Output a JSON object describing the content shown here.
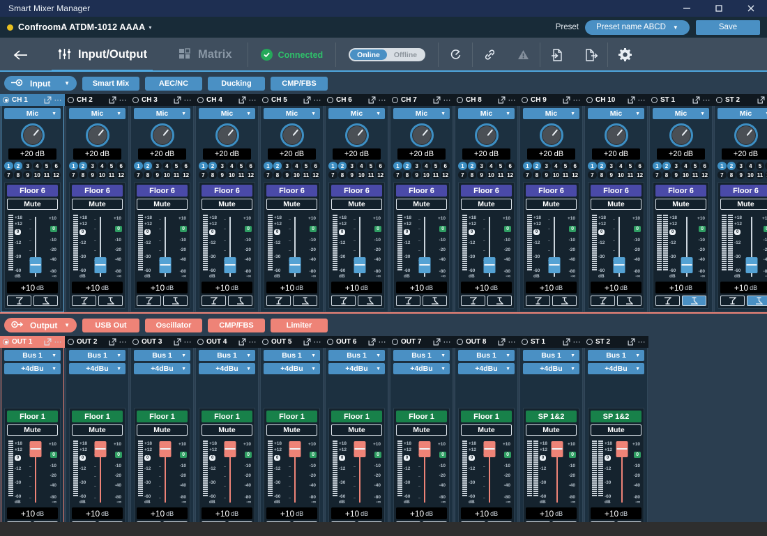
{
  "window": {
    "title": "Smart Mixer Manager",
    "minimize_icon": "minimize-icon",
    "maximize_icon": "maximize-icon",
    "close_icon": "close-icon"
  },
  "device_bar": {
    "status_dot_color": "#e8c020",
    "device_name": "ConfroomA ATDM-1012 AAAA",
    "caret": "▾",
    "preset_label": "Preset",
    "preset_value": "Preset name ABCD",
    "save_label": "Save"
  },
  "navbar": {
    "back_icon": "back-arrow-icon",
    "tabs": [
      {
        "label": "Input/Output",
        "icon": "sliders-icon",
        "active": true
      },
      {
        "label": "Matrix",
        "icon": "grid-icon",
        "active": false
      }
    ],
    "connection_status": "Connected",
    "online_label": "Online",
    "offline_label": "Offline",
    "online_active": true,
    "icons": [
      "refresh-icon",
      "link-icon",
      "warning-icon",
      "import-icon",
      "export-icon",
      "gear-icon"
    ],
    "accent_color": "#4fa8e0",
    "connected_color": "#2fc06a"
  },
  "input_section": {
    "pill_label": "Input",
    "pill_icon": "input-arrow-icon",
    "pill_color": "#4a90c4",
    "buttons": [
      "Smart Mix",
      "AEC/NC",
      "Ducking",
      "CMP/FBS"
    ],
    "scale_meter": [
      "+18",
      "+12",
      "0",
      "-12",
      "-30",
      "-60",
      "dB"
    ],
    "scale_fader": [
      "+10",
      "0",
      "-10",
      "-20",
      "-40",
      "-80",
      "-∞"
    ],
    "gain_unit": "dB",
    "mute_label": "Mute",
    "eq_icons": [
      "highpass-filter-icon",
      "lowpass-filter-icon"
    ],
    "num_pad": [
      "1",
      "2",
      "3",
      "4",
      "5",
      "6",
      "7",
      "8",
      "9",
      "10",
      "11",
      "12"
    ],
    "num_pad_active": [
      "1",
      "2"
    ],
    "channels": [
      {
        "name": "CH 1",
        "selected": true,
        "source": "Mic",
        "gain": "+20 dB",
        "bus": "Floor 6",
        "level": "+10",
        "stereo": false,
        "eq_left_on": false,
        "eq_right_on": false
      },
      {
        "name": "CH 2",
        "selected": false,
        "source": "Mic",
        "gain": "+20 dB",
        "bus": "Floor 6",
        "level": "+10",
        "stereo": false,
        "eq_left_on": false,
        "eq_right_on": false
      },
      {
        "name": "CH 3",
        "selected": false,
        "source": "Mic",
        "gain": "+20 dB",
        "bus": "Floor 6",
        "level": "+10",
        "stereo": false,
        "eq_left_on": false,
        "eq_right_on": false
      },
      {
        "name": "CH 4",
        "selected": false,
        "source": "Mic",
        "gain": "+20 dB",
        "bus": "Floor 6",
        "level": "+10",
        "stereo": false,
        "eq_left_on": false,
        "eq_right_on": false
      },
      {
        "name": "CH 5",
        "selected": false,
        "source": "Mic",
        "gain": "+20 dB",
        "bus": "Floor 6",
        "level": "+10",
        "stereo": false,
        "eq_left_on": false,
        "eq_right_on": false
      },
      {
        "name": "CH 6",
        "selected": false,
        "source": "Mic",
        "gain": "+20 dB",
        "bus": "Floor 6",
        "level": "+10",
        "stereo": false,
        "eq_left_on": false,
        "eq_right_on": false
      },
      {
        "name": "CH 7",
        "selected": false,
        "source": "Mic",
        "gain": "+20 dB",
        "bus": "Floor 6",
        "level": "+10",
        "stereo": false,
        "eq_left_on": false,
        "eq_right_on": false
      },
      {
        "name": "CH 8",
        "selected": false,
        "source": "Mic",
        "gain": "+20 dB",
        "bus": "Floor 6",
        "level": "+10",
        "stereo": false,
        "eq_left_on": false,
        "eq_right_on": false
      },
      {
        "name": "CH 9",
        "selected": false,
        "source": "Mic",
        "gain": "+20 dB",
        "bus": "Floor 6",
        "level": "+10",
        "stereo": false,
        "eq_left_on": false,
        "eq_right_on": false
      },
      {
        "name": "CH 10",
        "selected": false,
        "source": "Mic",
        "gain": "+20 dB",
        "bus": "Floor 6",
        "level": "+10",
        "stereo": false,
        "eq_left_on": false,
        "eq_right_on": false
      },
      {
        "name": "ST 1",
        "selected": false,
        "source": "Mic",
        "gain": "+20 dB",
        "bus": "Floor 6",
        "level": "+10",
        "stereo": true,
        "eq_left_on": false,
        "eq_right_on": true
      },
      {
        "name": "ST 2",
        "selected": false,
        "source": "Mic",
        "gain": "+20 dB",
        "bus": "Floor 6",
        "level": "+10",
        "stereo": true,
        "eq_left_on": false,
        "eq_right_on": true
      }
    ]
  },
  "output_section": {
    "pill_label": "Output",
    "pill_icon": "output-arrow-icon",
    "pill_color": "#ee8377",
    "buttons": [
      "USB Out",
      "Oscillator",
      "CMP/FBS",
      "Limiter"
    ],
    "mute_label": "Mute",
    "channels": [
      {
        "name": "OUT 1",
        "selected": true,
        "bus": "Bus 1",
        "level_ref": "+4dBu",
        "label": "Floor 1",
        "level": "+10",
        "stereo": false,
        "eq_left_on": true,
        "eq_right_on": false
      },
      {
        "name": "OUT 2",
        "selected": false,
        "bus": "Bus 1",
        "level_ref": "+4dBu",
        "label": "Floor 1",
        "level": "+10",
        "stereo": false,
        "eq_left_on": true,
        "eq_right_on": false
      },
      {
        "name": "OUT 3",
        "selected": false,
        "bus": "Bus 1",
        "level_ref": "+4dBu",
        "label": "Floor 1",
        "level": "+10",
        "stereo": false,
        "eq_left_on": true,
        "eq_right_on": false
      },
      {
        "name": "OUT 4",
        "selected": false,
        "bus": "Bus 1",
        "level_ref": "+4dBu",
        "label": "Floor 1",
        "level": "+10",
        "stereo": false,
        "eq_left_on": true,
        "eq_right_on": false
      },
      {
        "name": "OUT 5",
        "selected": false,
        "bus": "Bus 1",
        "level_ref": "+4dBu",
        "label": "Floor 1",
        "level": "+10",
        "stereo": false,
        "eq_left_on": true,
        "eq_right_on": false
      },
      {
        "name": "OUT 6",
        "selected": false,
        "bus": "Bus 1",
        "level_ref": "+4dBu",
        "label": "Floor 1",
        "level": "+10",
        "stereo": false,
        "eq_left_on": true,
        "eq_right_on": false
      },
      {
        "name": "OUT 7",
        "selected": false,
        "bus": "Bus 1",
        "level_ref": "+4dBu",
        "label": "Floor 1",
        "level": "+10",
        "stereo": false,
        "eq_left_on": true,
        "eq_right_on": false
      },
      {
        "name": "OUT 8",
        "selected": false,
        "bus": "Bus 1",
        "level_ref": "+4dBu",
        "label": "Floor 1",
        "level": "+10",
        "stereo": false,
        "eq_left_on": true,
        "eq_right_on": false
      },
      {
        "name": "ST 1",
        "selected": false,
        "bus": "Bus 1",
        "level_ref": "+4dBu",
        "label": "SP 1&2",
        "level": "+10",
        "stereo": true,
        "eq_left_on": true,
        "eq_right_on": false
      },
      {
        "name": "ST 2",
        "selected": false,
        "bus": "Bus 1",
        "level_ref": "+4dBu",
        "label": "SP 1&2",
        "level": "+10",
        "stereo": true,
        "eq_left_on": true,
        "eq_right_on": false
      }
    ]
  }
}
